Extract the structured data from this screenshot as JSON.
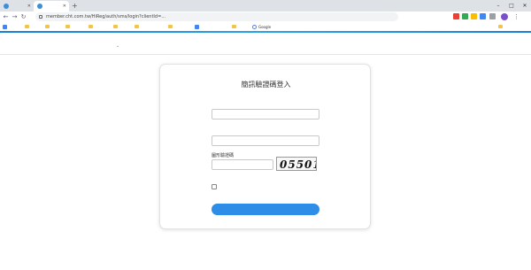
{
  "browser": {
    "tabs": [
      {
        "title": "",
        "active": false
      },
      {
        "title": "",
        "active": true
      }
    ],
    "new_tab_glyph": "+",
    "window_controls": [
      "–",
      "□",
      "✕"
    ],
    "url": "member.cht.com.tw/HiReg/auth/sms/login?clientId=...",
    "profile_initial": "",
    "menu_glyph": "⋮",
    "bookmarks": [
      {
        "label": "",
        "icon": "folder-icon"
      },
      {
        "label": "",
        "icon": "folder-icon"
      },
      {
        "label": "",
        "icon": "folder-icon"
      },
      {
        "label": "",
        "icon": "folder-icon"
      },
      {
        "label": "",
        "icon": "folder-icon"
      },
      {
        "label": "",
        "icon": "folder-icon"
      },
      {
        "label": "",
        "icon": "folder-icon"
      },
      {
        "label": "",
        "icon": "folder-icon"
      },
      {
        "label": "",
        "icon": "app-icon"
      },
      {
        "label": "",
        "icon": "folder-icon"
      },
      {
        "label": "Google",
        "icon": "google-icon"
      }
    ],
    "bookmarks_other": ""
  },
  "page": {
    "nav_chevron": "⌄",
    "card": {
      "title": "簡訊驗證碼登入",
      "phone_label": "",
      "phone_placeholder": "",
      "id_label": "",
      "id_placeholder": "",
      "captcha_label": "圖形驗證碼",
      "captcha_placeholder": "",
      "captcha_text": "05501",
      "captcha_refresh": "",
      "captcha_audio": "",
      "consent_label": "",
      "consent_note": "",
      "submit_label": ""
    }
  },
  "colors": {
    "accent": "#2e8de6",
    "link": "#2d7fd8"
  }
}
